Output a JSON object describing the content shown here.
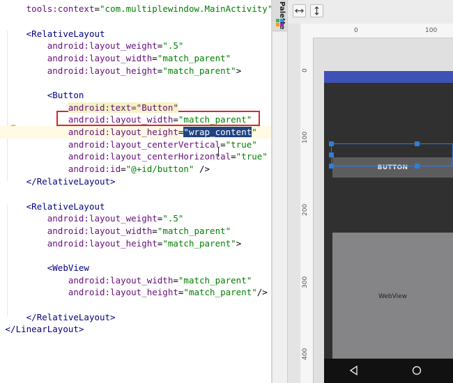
{
  "editor": {
    "lines": [
      {
        "indent": "    ",
        "parts": [
          [
            "attr",
            "tools:context"
          ],
          [
            "plain",
            "="
          ],
          [
            "val",
            "\"com.multiplewindow.MainActivity\""
          ],
          [
            "plain",
            ">"
          ]
        ]
      },
      {
        "indent": "",
        "parts": []
      },
      {
        "indent": "    ",
        "parts": [
          [
            "tag",
            "<RelativeLayout"
          ]
        ]
      },
      {
        "indent": "        ",
        "parts": [
          [
            "attr",
            "android:layout_weight"
          ],
          [
            "plain",
            "="
          ],
          [
            "val",
            "\".5\""
          ]
        ]
      },
      {
        "indent": "        ",
        "parts": [
          [
            "attr",
            "android:layout_width"
          ],
          [
            "plain",
            "="
          ],
          [
            "val",
            "\"match_parent\""
          ]
        ]
      },
      {
        "indent": "        ",
        "parts": [
          [
            "attr",
            "android:layout_height"
          ],
          [
            "plain",
            "="
          ],
          [
            "val",
            "\"match_parent\""
          ],
          [
            "plain",
            ">"
          ]
        ]
      },
      {
        "indent": "",
        "parts": []
      },
      {
        "indent": "        ",
        "parts": [
          [
            "tag",
            "<Button"
          ]
        ]
      },
      {
        "indent": "            ",
        "parts": [
          [
            "hl",
            "android:text=\"Button\""
          ]
        ]
      },
      {
        "indent": "            ",
        "parts": [
          [
            "attr",
            "android:layout_width"
          ],
          [
            "plain",
            "="
          ],
          [
            "val",
            "\"match_parent\""
          ]
        ]
      },
      {
        "indent": "            ",
        "parts": [
          [
            "attr",
            "android:layout_height"
          ],
          [
            "plain",
            "="
          ],
          [
            "sel",
            "\"wrap_content"
          ],
          [
            "val",
            "\""
          ]
        ]
      },
      {
        "indent": "            ",
        "parts": [
          [
            "attr",
            "android:layout_centerVertical"
          ],
          [
            "plain",
            "="
          ],
          [
            "val",
            "\"true\""
          ]
        ]
      },
      {
        "indent": "            ",
        "parts": [
          [
            "attr",
            "android:layout_centerHorizontal"
          ],
          [
            "plain",
            "="
          ],
          [
            "val",
            "\"true\""
          ]
        ]
      },
      {
        "indent": "            ",
        "parts": [
          [
            "attr",
            "android:id"
          ],
          [
            "plain",
            "="
          ],
          [
            "val",
            "\"@+id/button\""
          ],
          [
            "plain",
            " />"
          ]
        ]
      },
      {
        "indent": "    ",
        "parts": [
          [
            "tag",
            "</RelativeLayout>"
          ]
        ]
      },
      {
        "indent": "",
        "parts": []
      },
      {
        "indent": "    ",
        "parts": [
          [
            "tag",
            "<RelativeLayout"
          ]
        ]
      },
      {
        "indent": "        ",
        "parts": [
          [
            "attr",
            "android:layout_weight"
          ],
          [
            "plain",
            "="
          ],
          [
            "val",
            "\".5\""
          ]
        ]
      },
      {
        "indent": "        ",
        "parts": [
          [
            "attr",
            "android:layout_width"
          ],
          [
            "plain",
            "="
          ],
          [
            "val",
            "\"match_parent\""
          ]
        ]
      },
      {
        "indent": "        ",
        "parts": [
          [
            "attr",
            "android:layout_height"
          ],
          [
            "plain",
            "="
          ],
          [
            "val",
            "\"match_parent\""
          ],
          [
            "plain",
            ">"
          ]
        ]
      },
      {
        "indent": "",
        "parts": []
      },
      {
        "indent": "        ",
        "parts": [
          [
            "tag",
            "<WebView"
          ]
        ]
      },
      {
        "indent": "            ",
        "parts": [
          [
            "attr",
            "android:layout_width"
          ],
          [
            "plain",
            "="
          ],
          [
            "val",
            "\"match_parent\""
          ]
        ]
      },
      {
        "indent": "            ",
        "parts": [
          [
            "attr",
            "android:layout_height"
          ],
          [
            "plain",
            "="
          ],
          [
            "val",
            "\"match_parent\""
          ],
          [
            "plain",
            "/>"
          ]
        ]
      },
      {
        "indent": "",
        "parts": []
      },
      {
        "indent": "    ",
        "parts": [
          [
            "tag",
            "</RelativeLayout>"
          ]
        ]
      },
      {
        "indent": "",
        "parts": [
          [
            "tag",
            "</LinearLayout>"
          ]
        ]
      }
    ]
  },
  "palette": {
    "label": "Palette"
  },
  "ruler": {
    "top_ticks": [
      "0",
      "100"
    ],
    "left_ticks": [
      "0",
      "100",
      "200",
      "300",
      "400"
    ]
  },
  "preview": {
    "button_label": "BUTTON",
    "webview_label": "WebView",
    "status_color": "#3f51b5"
  }
}
